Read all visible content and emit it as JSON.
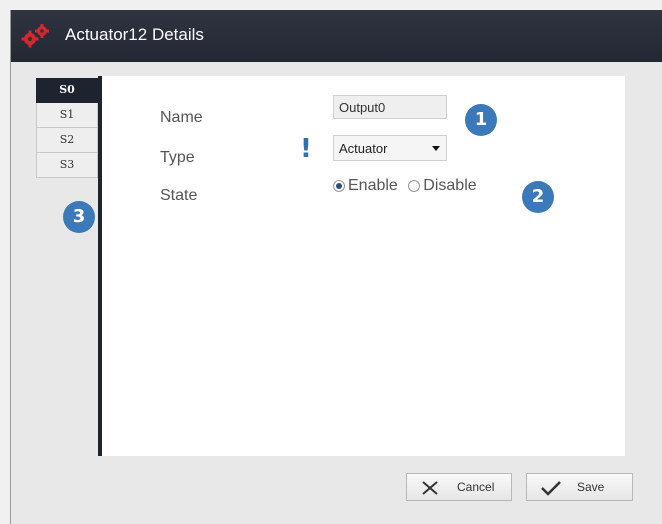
{
  "window": {
    "title": "Actuator12 Details",
    "icon": "gears-icon"
  },
  "tabs": [
    {
      "label": "S0",
      "active": true
    },
    {
      "label": "S1",
      "active": false
    },
    {
      "label": "S2",
      "active": false
    },
    {
      "label": "S3",
      "active": false
    }
  ],
  "form": {
    "name_label": "Name",
    "name_value": "Output0",
    "type_label": "Type",
    "type_value": "Actuator",
    "type_warning": "!",
    "state_label": "State",
    "state_options": [
      "Enable",
      "Disable"
    ],
    "state_selected": "Enable"
  },
  "callouts": [
    "1",
    "2",
    "3"
  ],
  "buttons": {
    "cancel": "Cancel",
    "save": "Save"
  },
  "colors": {
    "titlebar": "#2f3440",
    "accent": "#3c79b9",
    "tab_active": "#1e2330",
    "warning": "#2f6fb2",
    "icon": "#d9272e"
  }
}
